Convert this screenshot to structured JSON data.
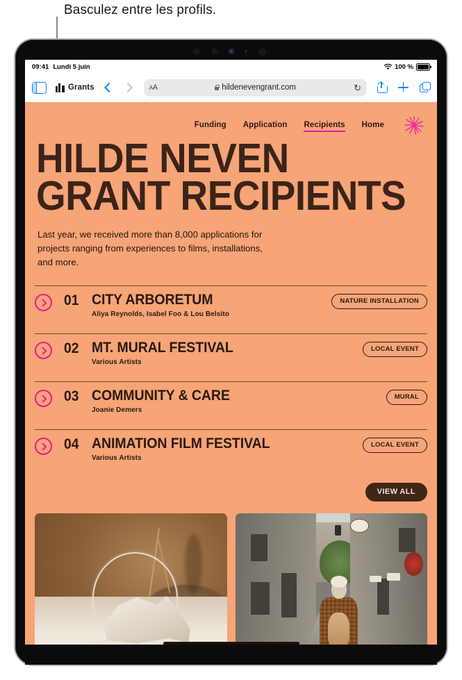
{
  "callout": {
    "text": "Basculez entre les profils."
  },
  "status_bar": {
    "time": "09:41",
    "date": "Lundi 5 juin",
    "wifi_icon": "wifi-icon",
    "battery_percent": "100 %",
    "battery_icon": "battery-full-icon"
  },
  "toolbar": {
    "sidebar_icon": "sidebar-icon",
    "profile_icon": "profile-grants-icon",
    "profile_name": "Grants",
    "back_icon": "chevron-left-icon",
    "forward_icon": "chevron-right-icon",
    "text_size_label": "AA",
    "lock_icon": "lock-icon",
    "url": "hildenevengrant.com",
    "reload_icon": "reload-icon",
    "share_icon": "share-icon",
    "new_tab_icon": "plus-icon",
    "tabs_icon": "tabs-icon"
  },
  "site": {
    "nav": [
      {
        "label": "Funding",
        "active": false
      },
      {
        "label": "Application",
        "active": false
      },
      {
        "label": "Recipients",
        "active": true
      },
      {
        "label": "Home",
        "active": false
      }
    ],
    "logo_icon": "flower-burst-logo",
    "heading_line1": "HILDE NEVEN",
    "heading_line2": "GRANT RECIPIENTS",
    "lede": "Last year, we received more than 8,000 applications for projects ranging from experiences to films, installations, and more.",
    "recipients": [
      {
        "arrow_icon": "arrow-right-circle-icon",
        "number": "01",
        "title": "CITY ARBORETUM",
        "artists": "Aliya Reynolds, Isabel Foo & Lou Belsito",
        "badge": "NATURE INSTALLATION"
      },
      {
        "arrow_icon": "arrow-right-circle-icon",
        "number": "02",
        "title": "MT. MURAL FESTIVAL",
        "artists": "Various Artists",
        "badge": "LOCAL EVENT"
      },
      {
        "arrow_icon": "arrow-right-circle-icon",
        "number": "03",
        "title": "COMMUNITY & CARE",
        "artists": "Joanie Demers",
        "badge": "MURAL"
      },
      {
        "arrow_icon": "arrow-right-circle-icon",
        "number": "04",
        "title": "ANIMATION FILM FESTIVAL",
        "artists": "Various Artists",
        "badge": "LOCAL EVENT"
      }
    ],
    "view_all_label": "VIEW ALL",
    "gallery": [
      {
        "name": "installation-photo"
      },
      {
        "name": "alley-photo"
      }
    ]
  },
  "colors": {
    "page_background": "#F7A477",
    "ink": "#2B1A11",
    "accent_pink": "#E8199B",
    "button_dark": "#3F2618",
    "browser_blue": "#0A84FF"
  }
}
